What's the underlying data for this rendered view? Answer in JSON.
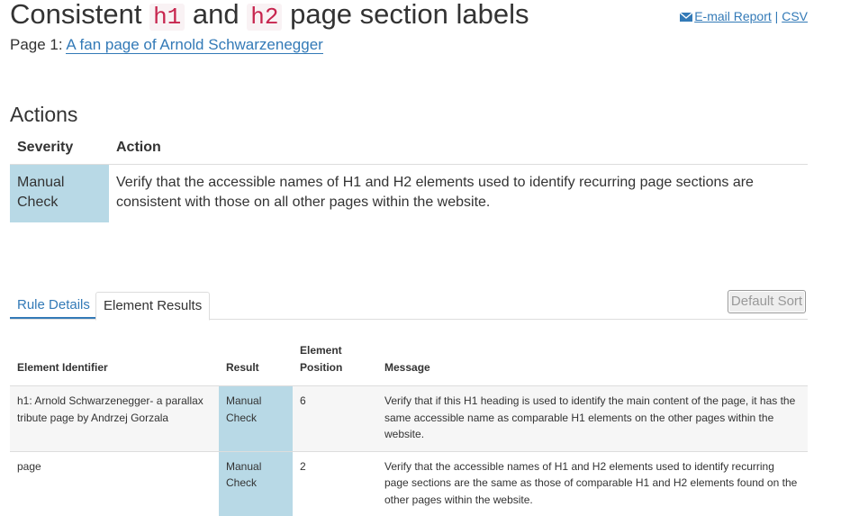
{
  "header": {
    "title_part1": "Consistent ",
    "title_code1": "h1",
    "title_part2": " and ",
    "title_code2": "h2",
    "title_part3": " page section labels",
    "page_label": "Page 1: ",
    "page_link": "A fan page of Arnold Schwarzenegger",
    "email_report": "E-mail Report",
    "separator": " | ",
    "csv": "CSV"
  },
  "actions": {
    "heading": "Actions",
    "columns": [
      "Severity",
      "Action"
    ],
    "rows": [
      {
        "severity": "Manual Check",
        "action": "Verify that the accessible names of H1 and H2 elements used to identify recurring page sections are consistent with those on all other pages within the website."
      }
    ]
  },
  "tabs": [
    {
      "label": "Rule Details",
      "active": false
    },
    {
      "label": "Element Results",
      "active": true
    }
  ],
  "sort_button": "Default Sort",
  "results": {
    "columns": [
      "Element Identifier",
      "Result",
      "Element Position",
      "Message"
    ],
    "rows": [
      {
        "identifier": "h1: Arnold Schwarzenegger- a parallax tribute page by Andrzej Gorzala",
        "result": "Manual Check",
        "position": "6",
        "message": "Verify that if this H1 heading is used to identify the main content of the page, it has the same accessible name as comparable H1 elements on the other pages within the website."
      },
      {
        "identifier": "page",
        "result": "Manual Check",
        "position": "2",
        "message": "Verify that the accessible names of H1 and H2 elements used to identify recurring page sections are the same as those of comparable H1 and H2 elements found on the other pages within the website."
      }
    ]
  },
  "colors": {
    "link": "#337ab7",
    "manual_check_bg": "#b8d9e6",
    "code_text": "#c7254e",
    "code_bg": "#f9f2f4"
  },
  "icons": {
    "email": "envelope-icon"
  }
}
